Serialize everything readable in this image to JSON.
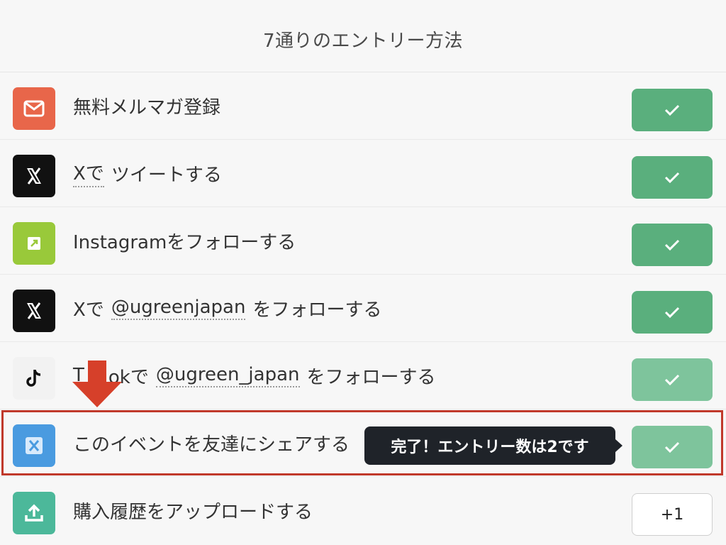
{
  "header": {
    "title": "7通りのエントリー方法"
  },
  "entries": [
    {
      "label": "無料メルマガ登録",
      "icon": "mail-icon",
      "icon_color": "#e8664a",
      "status": "done"
    },
    {
      "prefix": "Xで",
      "label": "ツイートする",
      "icon": "x-logo-icon",
      "icon_color": "#111111",
      "status": "done"
    },
    {
      "label": "Instagramをフォローする",
      "icon": "external-link-icon",
      "icon_color": "#99c93a",
      "status": "done"
    },
    {
      "prefix": "Xで",
      "handle": "@ugreenjapan",
      "suffix": "をフォローする",
      "icon": "x-logo-icon",
      "icon_color": "#111111",
      "status": "done"
    },
    {
      "prefix_visible": "T",
      "prefix_after_arrow": "okで",
      "handle": "@ugreen_japan",
      "suffix": "をフォローする",
      "icon": "tiktok-icon",
      "icon_color": "#f2f2f2",
      "status": "done"
    },
    {
      "label": "このイベントを友達にシェアする",
      "icon": "x-logo-icon",
      "icon_color": "#4a9be0",
      "status": "done"
    },
    {
      "label": "購入履歴をアップロードする",
      "icon": "upload-icon",
      "icon_color": "#4cb89a",
      "status": "pending",
      "button_label": "+1"
    }
  ],
  "tooltip": {
    "text": "完了！エントリー数は2です"
  },
  "colors": {
    "done": "#5aaf7d",
    "done_light": "#7ec49c",
    "highlight": "#c0392b",
    "arrow": "#d6402a"
  }
}
